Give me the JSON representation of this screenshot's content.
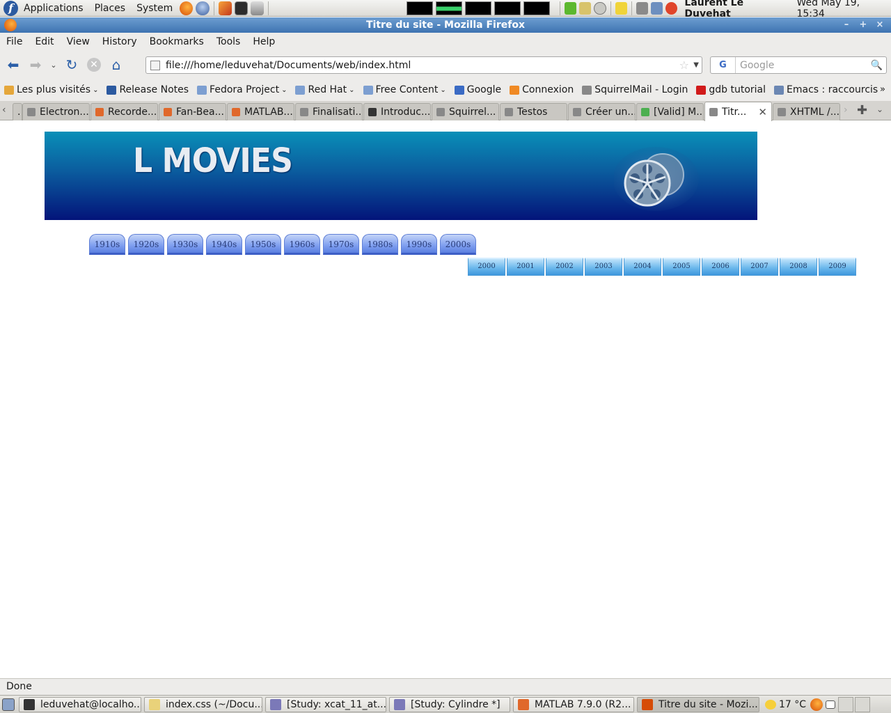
{
  "top_panel": {
    "menus": [
      "Applications",
      "Places",
      "System"
    ],
    "user": "Laurent Le Duvehat",
    "clock": "Wed May 19, 15:34"
  },
  "window": {
    "title": "Titre du site - Mozilla Firefox",
    "minimize": "–",
    "maximize": "+",
    "close": "×"
  },
  "menubar": {
    "items": [
      "File",
      "Edit",
      "View",
      "History",
      "Bookmarks",
      "Tools",
      "Help"
    ]
  },
  "navbar": {
    "url": "file:///home/leduvehat/Documents/web/index.html",
    "search_placeholder": "Google",
    "search_engine": "G"
  },
  "bookmarks": {
    "items": [
      {
        "label": "Les plus visités",
        "caret": true,
        "color": "#e5a73b"
      },
      {
        "label": "Release Notes",
        "caret": false,
        "color": "#2c5aa0"
      },
      {
        "label": "Fedora Project",
        "caret": true,
        "color": "#7d9fd1"
      },
      {
        "label": "Red Hat",
        "caret": true,
        "color": "#7d9fd1"
      },
      {
        "label": "Free Content",
        "caret": true,
        "color": "#7d9fd1"
      },
      {
        "label": "Google",
        "caret": false,
        "color": "#3b6bc4"
      },
      {
        "label": "Connexion",
        "caret": false,
        "color": "#f08a24"
      },
      {
        "label": "SquirrelMail - Login",
        "caret": false,
        "color": "#888888"
      },
      {
        "label": "gdb tutorial",
        "caret": false,
        "color": "#d11b1b"
      },
      {
        "label": "Emacs : raccourcis",
        "caret": false,
        "color": "#6b87b3"
      }
    ],
    "more": "»"
  },
  "tabs": {
    "items": [
      {
        "label": "...",
        "color": "#c9c7c2"
      },
      {
        "label": "Electron...",
        "color": "#888888"
      },
      {
        "label": "Recorde...",
        "color": "#e0682b"
      },
      {
        "label": "Fan-Bea...",
        "color": "#e0682b"
      },
      {
        "label": "MATLAB...",
        "color": "#e0682b"
      },
      {
        "label": "Finalisati...",
        "color": "#888888"
      },
      {
        "label": "Introduc...",
        "color": "#333333"
      },
      {
        "label": "Squirrel...",
        "color": "#888888"
      },
      {
        "label": "Testos",
        "color": "#888888"
      },
      {
        "label": "Créer un...",
        "color": "#888888"
      },
      {
        "label": "[Valid] M...",
        "color": "#4caf50"
      },
      {
        "label": "Titr...",
        "color": "#888888"
      },
      {
        "label": "XHTML /...",
        "color": "#888888"
      }
    ],
    "active_index": 11
  },
  "page": {
    "banner_title": "L MOVIES",
    "decades": [
      "1910s",
      "1920s",
      "1930s",
      "1940s",
      "1950s",
      "1960s",
      "1970s",
      "1980s",
      "1990s",
      "2000s"
    ],
    "years": [
      "2000",
      "2001",
      "2002",
      "2003",
      "2004",
      "2005",
      "2006",
      "2007",
      "2008",
      "2009"
    ]
  },
  "status": {
    "text": "Done"
  },
  "taskbar": {
    "items": [
      {
        "label": "leduvehat@localho...",
        "color": "#333333",
        "active": false
      },
      {
        "label": "index.css (~/Docu...",
        "color": "#e9d27a",
        "active": false
      },
      {
        "label": "[Study: xcat_11_at...",
        "color": "#7b79b8",
        "active": false
      },
      {
        "label": "[Study: Cylindre *]",
        "color": "#7b79b8",
        "active": false
      },
      {
        "label": "MATLAB  7.9.0 (R2...",
        "color": "#e0682b",
        "active": false
      },
      {
        "label": "Titre du site - Mozi...",
        "color": "#d64c06",
        "active": true
      }
    ],
    "weather": "17 °C"
  }
}
